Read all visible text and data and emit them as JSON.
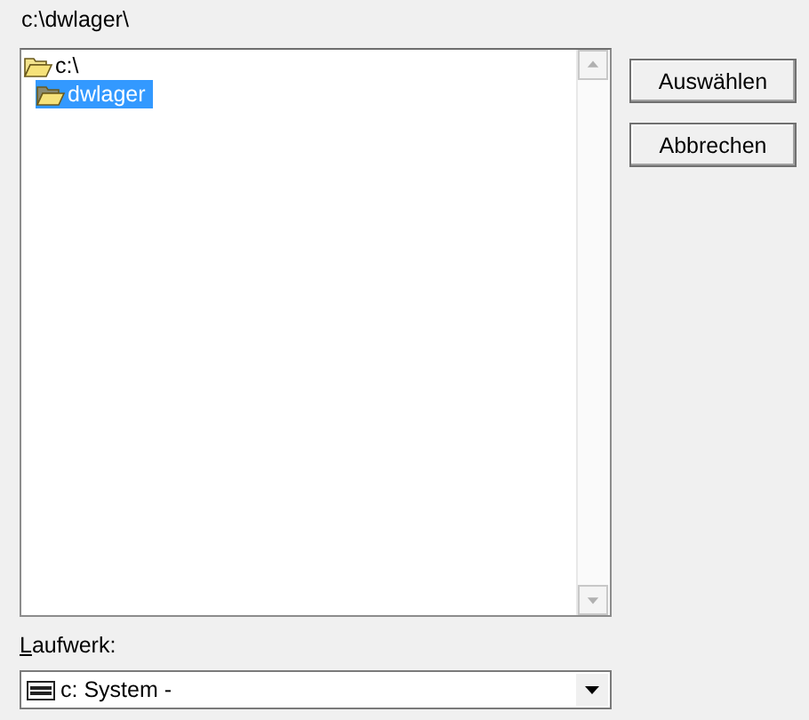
{
  "path_label": "c:\\dwlager\\",
  "folders": [
    {
      "name": "c:\\",
      "selected": false,
      "children": [
        {
          "name": "dwlager",
          "selected": true
        }
      ]
    }
  ],
  "buttons": [
    "Auswählen",
    "Abbrechen"
  ],
  "drive_label": "Laufwerk:",
  "drive": {
    "value": "c: System -"
  }
}
